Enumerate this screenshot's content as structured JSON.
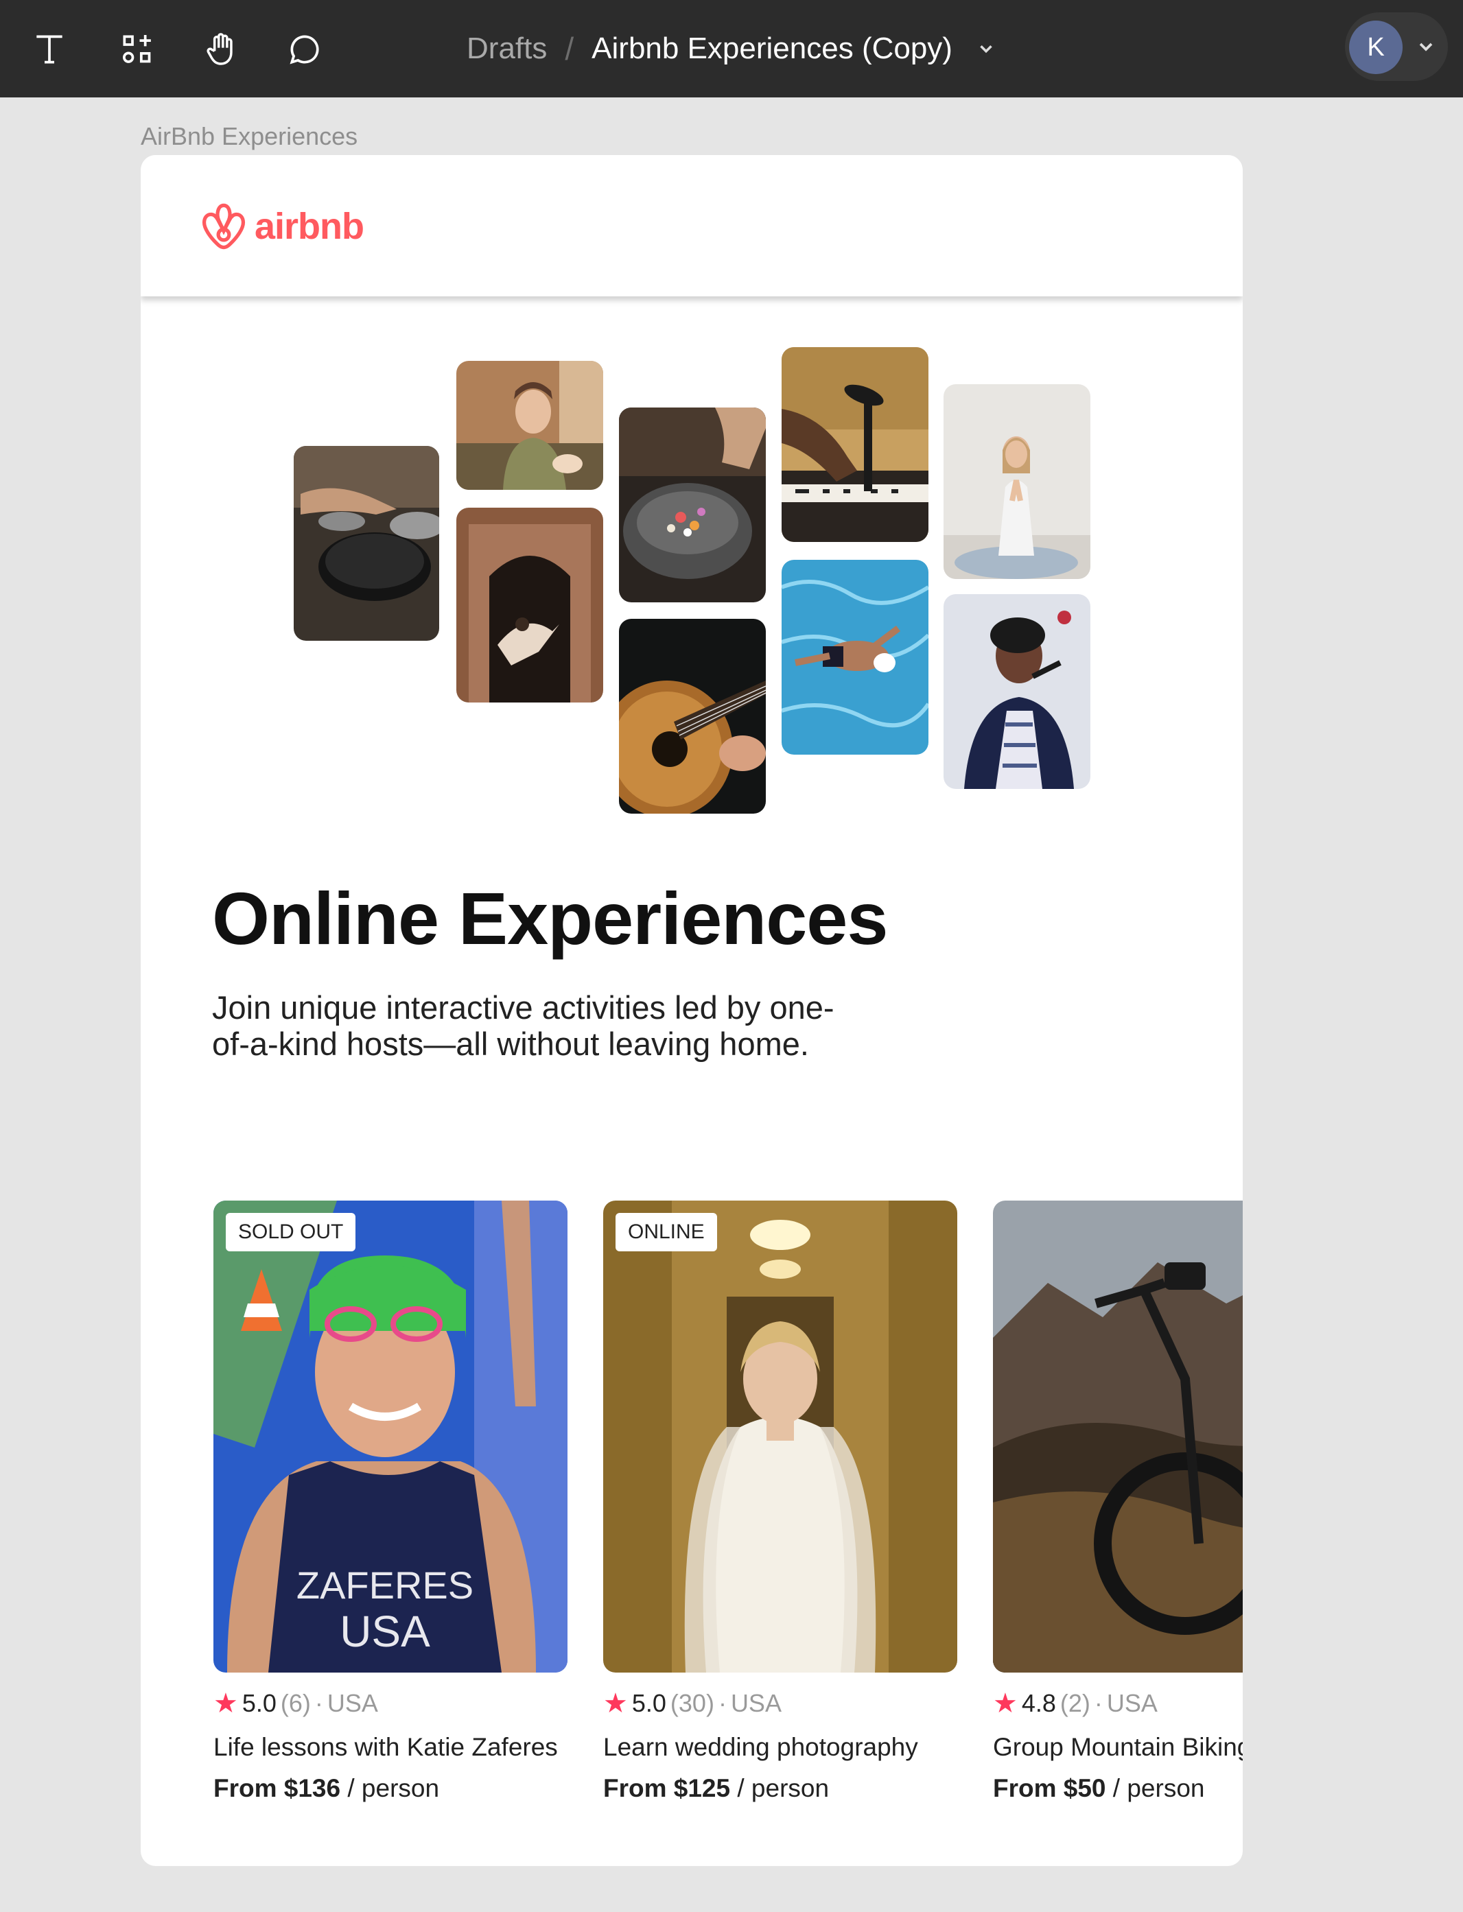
{
  "toolbar": {
    "tools": [
      "text-tool",
      "components-tool",
      "hand-tool",
      "comment-tool"
    ],
    "breadcrumb_root": "Drafts",
    "breadcrumb_sep": "/",
    "file_name": "Airbnb Experiences (Copy)",
    "user_initial": "K"
  },
  "frame": {
    "label": "AirBnb Experiences"
  },
  "nav": {
    "logo_text": "airbnb",
    "brand_color": "#FF5A5F"
  },
  "hero": {
    "title": "Online Experiences",
    "subtitle": "Join unique interactive activities led by one-of-a-kind hosts—all without leaving home."
  },
  "cards": [
    {
      "badge": "SOLD OUT",
      "rating": "5.0",
      "reviews": "(6)",
      "dot": "·",
      "location": "USA",
      "title": "Life lessons with Katie Zaferes",
      "price_prefix": "From $136",
      "price_suffix": " / person"
    },
    {
      "badge": "ONLINE",
      "rating": "5.0",
      "reviews": "(30)",
      "dot": "·",
      "location": "USA",
      "title": "Learn wedding photography",
      "price_prefix": "From $125",
      "price_suffix": " / person"
    },
    {
      "badge": "",
      "rating": "4.8",
      "reviews": "(2)",
      "dot": "·",
      "location": "USA",
      "title": "Group Mountain Biking",
      "price_prefix": "From $50",
      "price_suffix": " / person"
    }
  ],
  "colors": {
    "star": "#FE385C",
    "toolbar_bg": "#2C2C2C",
    "canvas_bg": "#E5E5E5"
  }
}
